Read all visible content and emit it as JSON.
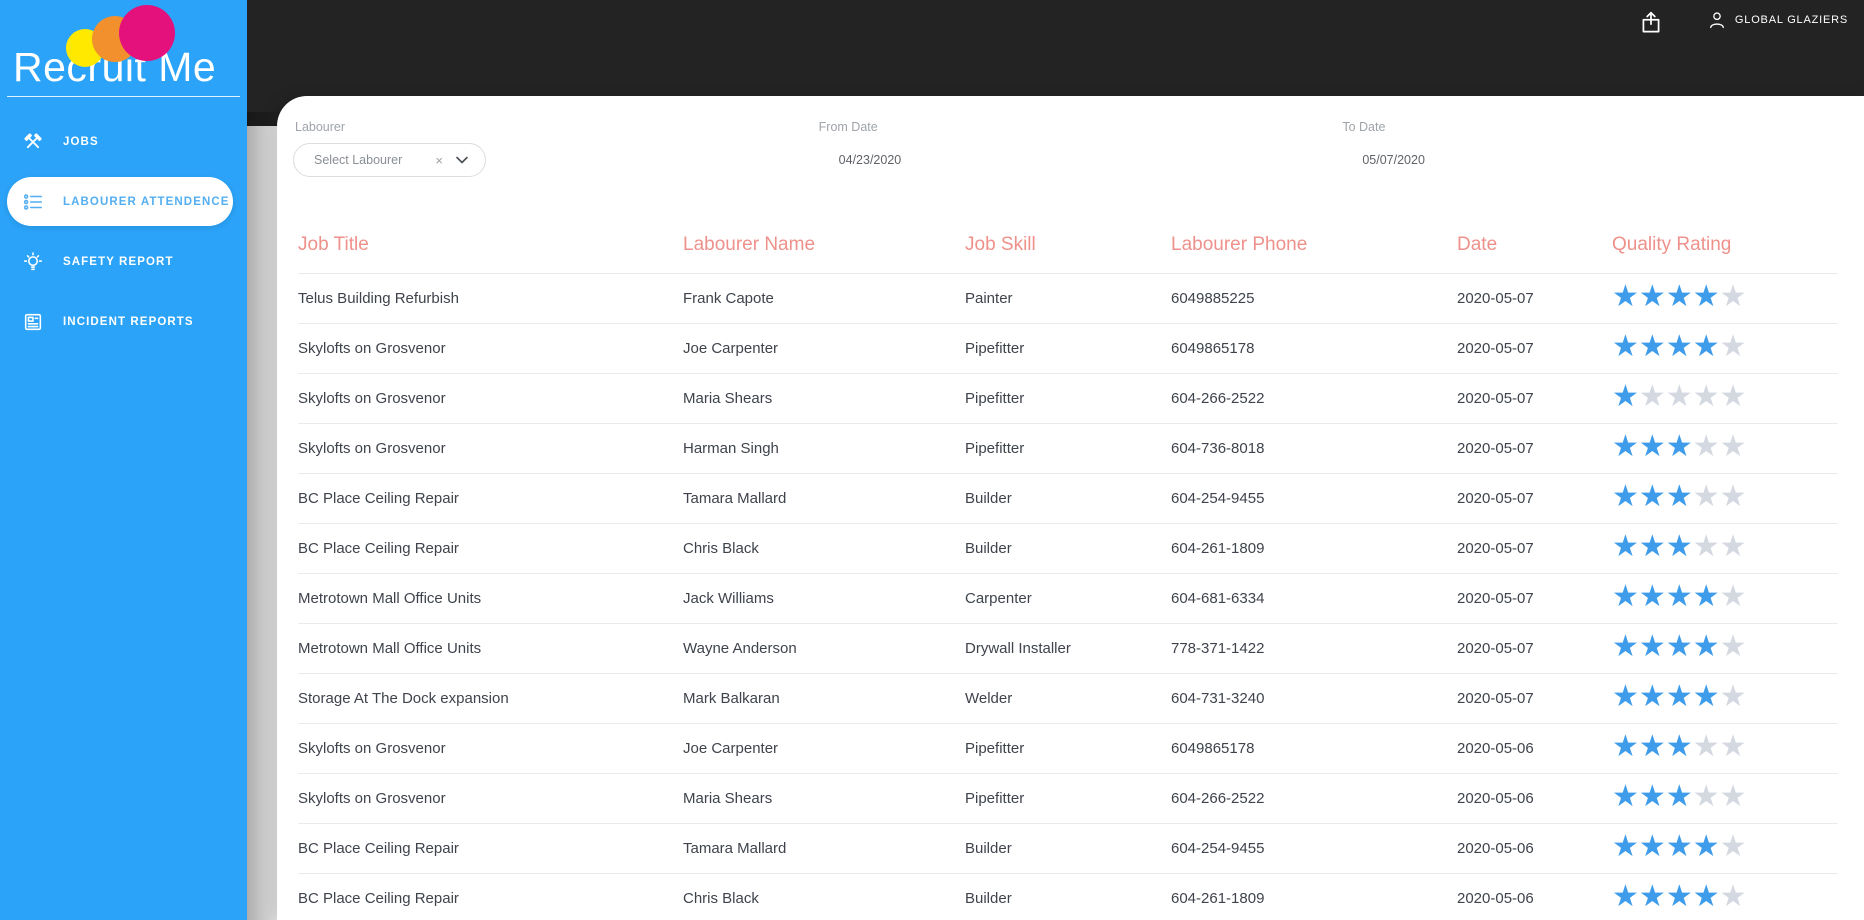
{
  "sidebar": {
    "logo_text": "Recruit Me",
    "logo_dot_colors": {
      "yellow": "#FFE900",
      "orange": "#F1902C",
      "pink": "#E4117D"
    },
    "items": [
      {
        "label": "JOBS",
        "icon": "tools-icon",
        "active": false
      },
      {
        "label": "LABOURER ATTENDENCE",
        "icon": "list-icon",
        "active": true
      },
      {
        "label": "SAFETY REPORT",
        "icon": "lightbulb-icon",
        "active": false
      },
      {
        "label": "INCIDENT REPORTS",
        "icon": "report-icon",
        "active": false
      }
    ]
  },
  "topbar": {
    "account_name": "GLOBAL GLAZIERS"
  },
  "filters": {
    "labourer": {
      "label": "Labourer",
      "value": "Select Labourer",
      "clear_glyph": "×"
    },
    "from_date": {
      "label": "From Date",
      "value": "04/23/2020"
    },
    "to_date": {
      "label": "To Date",
      "value": "05/07/2020"
    }
  },
  "table": {
    "columns": [
      "Job Title",
      "Labourer Name",
      "Job Skill",
      "Labourer Phone",
      "Date",
      "Quality Rating"
    ],
    "rating_max": 5,
    "star_glyph": "★",
    "rows": [
      {
        "job_title": "Telus Building Refurbish",
        "labourer_name": "Frank Capote",
        "job_skill": "Painter",
        "labourer_phone": "6049885225",
        "date": "2020-05-07",
        "rating": 4
      },
      {
        "job_title": "Skylofts on Grosvenor",
        "labourer_name": "Joe Carpenter",
        "job_skill": "Pipefitter",
        "labourer_phone": "6049865178",
        "date": "2020-05-07",
        "rating": 4
      },
      {
        "job_title": "Skylofts on Grosvenor",
        "labourer_name": "Maria Shears",
        "job_skill": "Pipefitter",
        "labourer_phone": "604-266-2522",
        "date": "2020-05-07",
        "rating": 1
      },
      {
        "job_title": "Skylofts on Grosvenor",
        "labourer_name": "Harman Singh",
        "job_skill": "Pipefitter",
        "labourer_phone": "604-736-8018",
        "date": "2020-05-07",
        "rating": 3
      },
      {
        "job_title": "BC Place Ceiling Repair",
        "labourer_name": "Tamara Mallard",
        "job_skill": "Builder",
        "labourer_phone": "604-254-9455",
        "date": "2020-05-07",
        "rating": 3
      },
      {
        "job_title": "BC Place Ceiling Repair",
        "labourer_name": "Chris Black",
        "job_skill": "Builder",
        "labourer_phone": "604-261-1809",
        "date": "2020-05-07",
        "rating": 3
      },
      {
        "job_title": "Metrotown Mall Office Units",
        "labourer_name": "Jack Williams",
        "job_skill": "Carpenter",
        "labourer_phone": "604-681-6334",
        "date": "2020-05-07",
        "rating": 4
      },
      {
        "job_title": "Metrotown Mall Office Units",
        "labourer_name": "Wayne Anderson",
        "job_skill": "Drywall Installer",
        "labourer_phone": "778-371-1422",
        "date": "2020-05-07",
        "rating": 4
      },
      {
        "job_title": "Storage At The Dock expansion",
        "labourer_name": "Mark Balkaran",
        "job_skill": "Welder",
        "labourer_phone": "604-731-3240",
        "date": "2020-05-07",
        "rating": 4
      },
      {
        "job_title": "Skylofts on Grosvenor",
        "labourer_name": "Joe Carpenter",
        "job_skill": "Pipefitter",
        "labourer_phone": "6049865178",
        "date": "2020-05-06",
        "rating": 3
      },
      {
        "job_title": "Skylofts on Grosvenor",
        "labourer_name": "Maria Shears",
        "job_skill": "Pipefitter",
        "labourer_phone": "604-266-2522",
        "date": "2020-05-06",
        "rating": 3
      },
      {
        "job_title": "BC Place Ceiling Repair",
        "labourer_name": "Tamara Mallard",
        "job_skill": "Builder",
        "labourer_phone": "604-254-9455",
        "date": "2020-05-06",
        "rating": 4
      },
      {
        "job_title": "BC Place Ceiling Repair",
        "labourer_name": "Chris Black",
        "job_skill": "Builder",
        "labourer_phone": "604-261-1809",
        "date": "2020-05-06",
        "rating": 4
      }
    ]
  },
  "colors": {
    "sidebar_blue": "#2BA3F8",
    "active_item_blue": "#54AEF2",
    "topbar_dark": "#232323",
    "header_coral": "#EF918B",
    "star_on": "#3E9CEA",
    "star_off": "#D4D9E1",
    "body_text": "#3E434C"
  }
}
